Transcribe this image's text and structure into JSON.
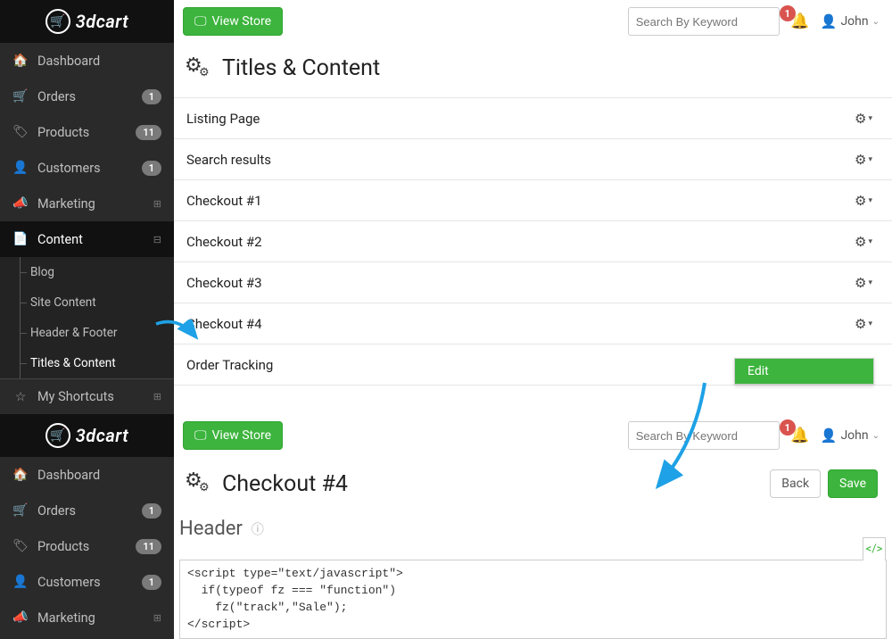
{
  "brand": "3dcart",
  "search_placeholder": "Search By Keyword",
  "notif_count": "1",
  "user_name": "John",
  "view_store_label": "View Store",
  "sidebar": {
    "dashboard": "Dashboard",
    "orders": "Orders",
    "orders_badge": "1",
    "products": "Products",
    "products_badge": "11",
    "customers": "Customers",
    "customers_badge": "1",
    "marketing": "Marketing",
    "content": "Content",
    "sub_blog": "Blog",
    "sub_site_content": "Site Content",
    "sub_header_footer": "Header & Footer",
    "sub_titles_content": "Titles & Content",
    "shortcuts": "My Shortcuts"
  },
  "screen1": {
    "title": "Titles & Content",
    "rows": {
      "r0": "Listing Page",
      "r1": "Search results",
      "r2": "Checkout #1",
      "r3": "Checkout #2",
      "r4": "Checkout #3",
      "r5": "Checkout #4",
      "r6": "Order Tracking"
    },
    "edit_label": "Edit"
  },
  "screen2": {
    "title": "Checkout #4",
    "back": "Back",
    "save": "Save",
    "section": "Header",
    "code": "<script type=\"text/javascript\">\n  if(typeof fz === \"function\")\n    fz(\"track\",\"Sale\");\n</script>"
  }
}
